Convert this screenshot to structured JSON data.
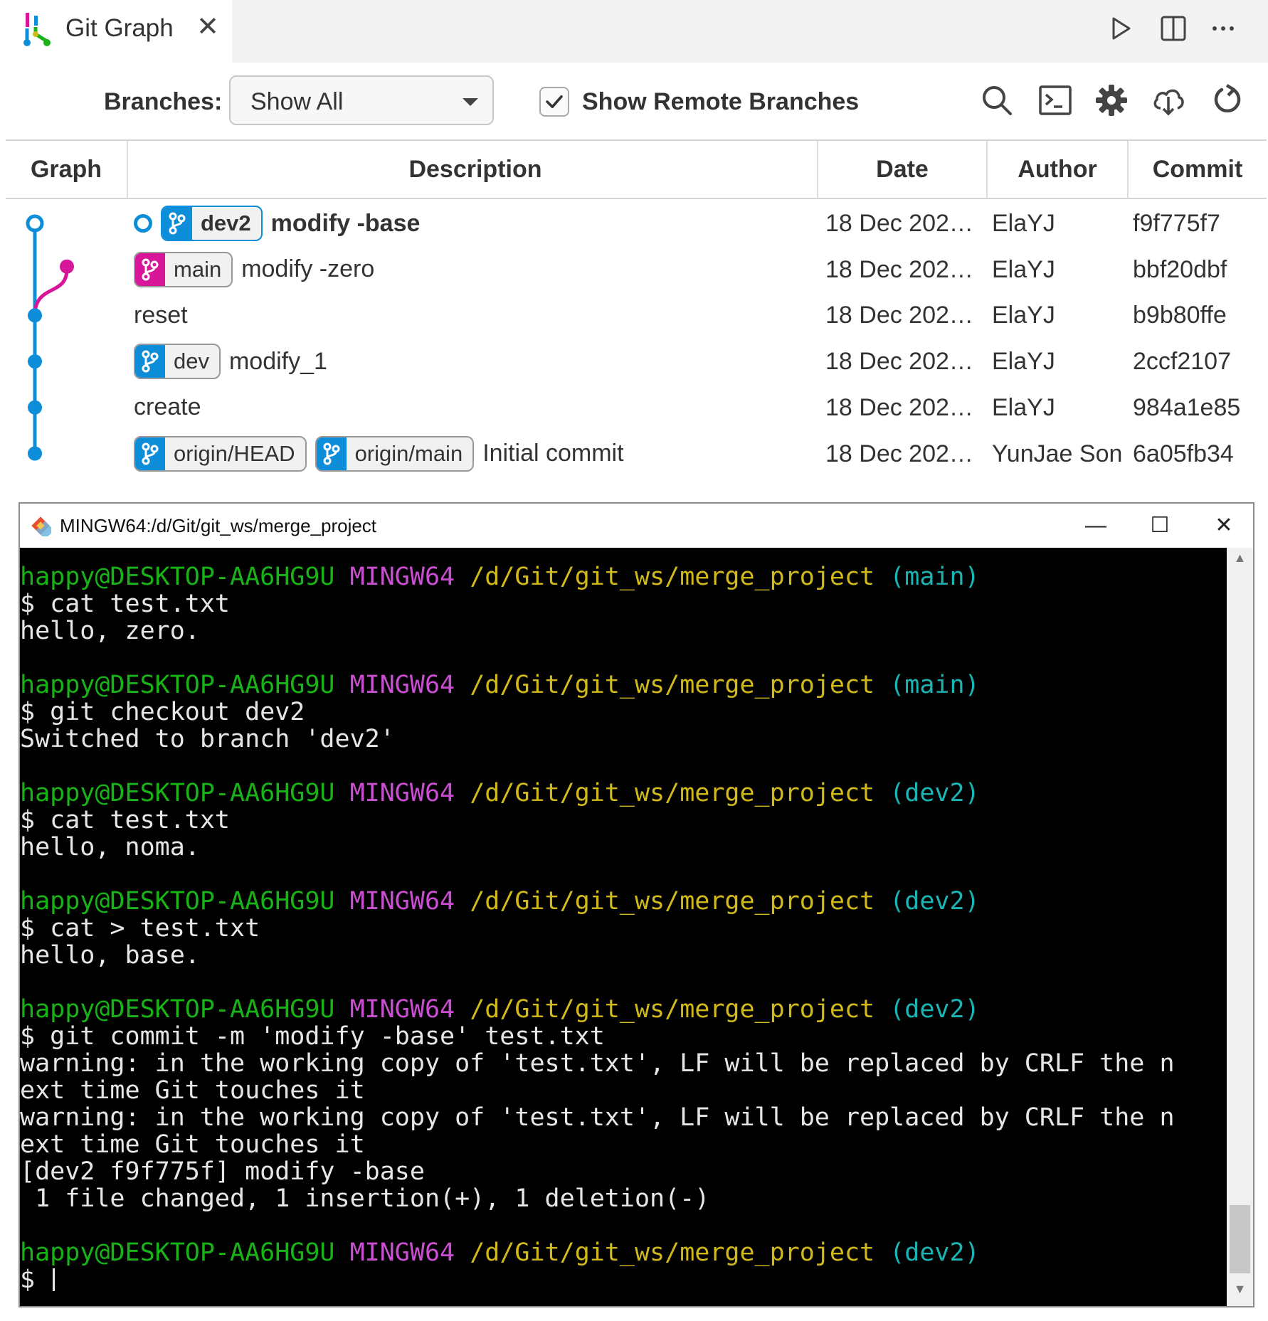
{
  "tab": {
    "title": "Git Graph",
    "close_glyph": "✕"
  },
  "toolbar_icons": [
    "run-icon",
    "split-editor-icon",
    "more-actions-icon"
  ],
  "controls": {
    "branches_label": "Branches:",
    "branches_value": "Show All",
    "show_remote_label": "Show Remote Branches",
    "show_remote_checked": true,
    "icons": [
      "search-icon",
      "terminal-icon",
      "gear-icon",
      "fetch-icon",
      "refresh-icon"
    ]
  },
  "table": {
    "headers": [
      "Graph",
      "Description",
      "Date",
      "Author",
      "Commit"
    ],
    "commits": [
      {
        "message": "modify -base",
        "bold": true,
        "head": true,
        "refs": [
          {
            "name": "dev2",
            "color": "#0e8ed9",
            "bold": true
          }
        ],
        "date": "18 Dec 202…",
        "author": "ElaYJ",
        "hash": "f9f775f7"
      },
      {
        "message": "modify -zero",
        "bold": false,
        "head": false,
        "refs": [
          {
            "name": "main",
            "color": "#d8169a",
            "bold": false
          }
        ],
        "date": "18 Dec 202…",
        "author": "ElaYJ",
        "hash": "bbf20dbf"
      },
      {
        "message": "reset",
        "bold": false,
        "head": false,
        "refs": [],
        "date": "18 Dec 202…",
        "author": "ElaYJ",
        "hash": "b9b80ffe"
      },
      {
        "message": "modify_1",
        "bold": false,
        "head": false,
        "refs": [
          {
            "name": "dev",
            "color": "#0e8ed9",
            "bold": false
          }
        ],
        "date": "18 Dec 202…",
        "author": "ElaYJ",
        "hash": "2ccf2107"
      },
      {
        "message": "create",
        "bold": false,
        "head": false,
        "refs": [],
        "date": "18 Dec 202…",
        "author": "ElaYJ",
        "hash": "984a1e85"
      },
      {
        "message": "Initial commit",
        "bold": false,
        "head": false,
        "refs": [
          {
            "name": "origin/HEAD",
            "color": "#0e8ed9",
            "bold": false
          },
          {
            "name": "origin/main",
            "color": "#0e8ed9",
            "bold": false
          }
        ],
        "date": "18 Dec 202…",
        "author": "YunJae Son",
        "hash": "6a05fb34"
      }
    ]
  },
  "graph_colors": {
    "dev2": "#0e8ed9",
    "main": "#d8169a"
  },
  "terminal": {
    "title": "MINGW64:/d/Git/git_ws/merge_project",
    "window_buttons": [
      "—",
      "☐",
      "✕"
    ],
    "prompt": {
      "user": "happy@DESKTOP-AA6HG9U",
      "system": "MINGW64",
      "path": "/d/Git/git_ws/merge_project"
    },
    "lines": [
      {
        "type": "prompt",
        "branch": "(main)"
      },
      {
        "type": "text",
        "text": "$ cat test.txt"
      },
      {
        "type": "text",
        "text": "hello, zero."
      },
      {
        "type": "blank"
      },
      {
        "type": "prompt",
        "branch": "(main)"
      },
      {
        "type": "text",
        "text": "$ git checkout dev2"
      },
      {
        "type": "text",
        "text": "Switched to branch 'dev2'"
      },
      {
        "type": "blank"
      },
      {
        "type": "prompt",
        "branch": "(dev2)"
      },
      {
        "type": "text",
        "text": "$ cat test.txt"
      },
      {
        "type": "text",
        "text": "hello, noma."
      },
      {
        "type": "blank"
      },
      {
        "type": "prompt",
        "branch": "(dev2)"
      },
      {
        "type": "text",
        "text": "$ cat > test.txt"
      },
      {
        "type": "text",
        "text": "hello, base."
      },
      {
        "type": "blank"
      },
      {
        "type": "prompt",
        "branch": "(dev2)"
      },
      {
        "type": "text",
        "text": "$ git commit -m 'modify -base' test.txt"
      },
      {
        "type": "text",
        "text": "warning: in the working copy of 'test.txt', LF will be replaced by CRLF the n"
      },
      {
        "type": "text",
        "text": "ext time Git touches it"
      },
      {
        "type": "text",
        "text": "warning: in the working copy of 'test.txt', LF will be replaced by CRLF the n"
      },
      {
        "type": "text",
        "text": "ext time Git touches it"
      },
      {
        "type": "text",
        "text": "[dev2 f9f775f] modify -base"
      },
      {
        "type": "text",
        "text": " 1 file changed, 1 insertion(+), 1 deletion(-)"
      },
      {
        "type": "blank"
      },
      {
        "type": "prompt",
        "branch": "(dev2)"
      },
      {
        "type": "cursor",
        "text": "$ "
      }
    ]
  }
}
